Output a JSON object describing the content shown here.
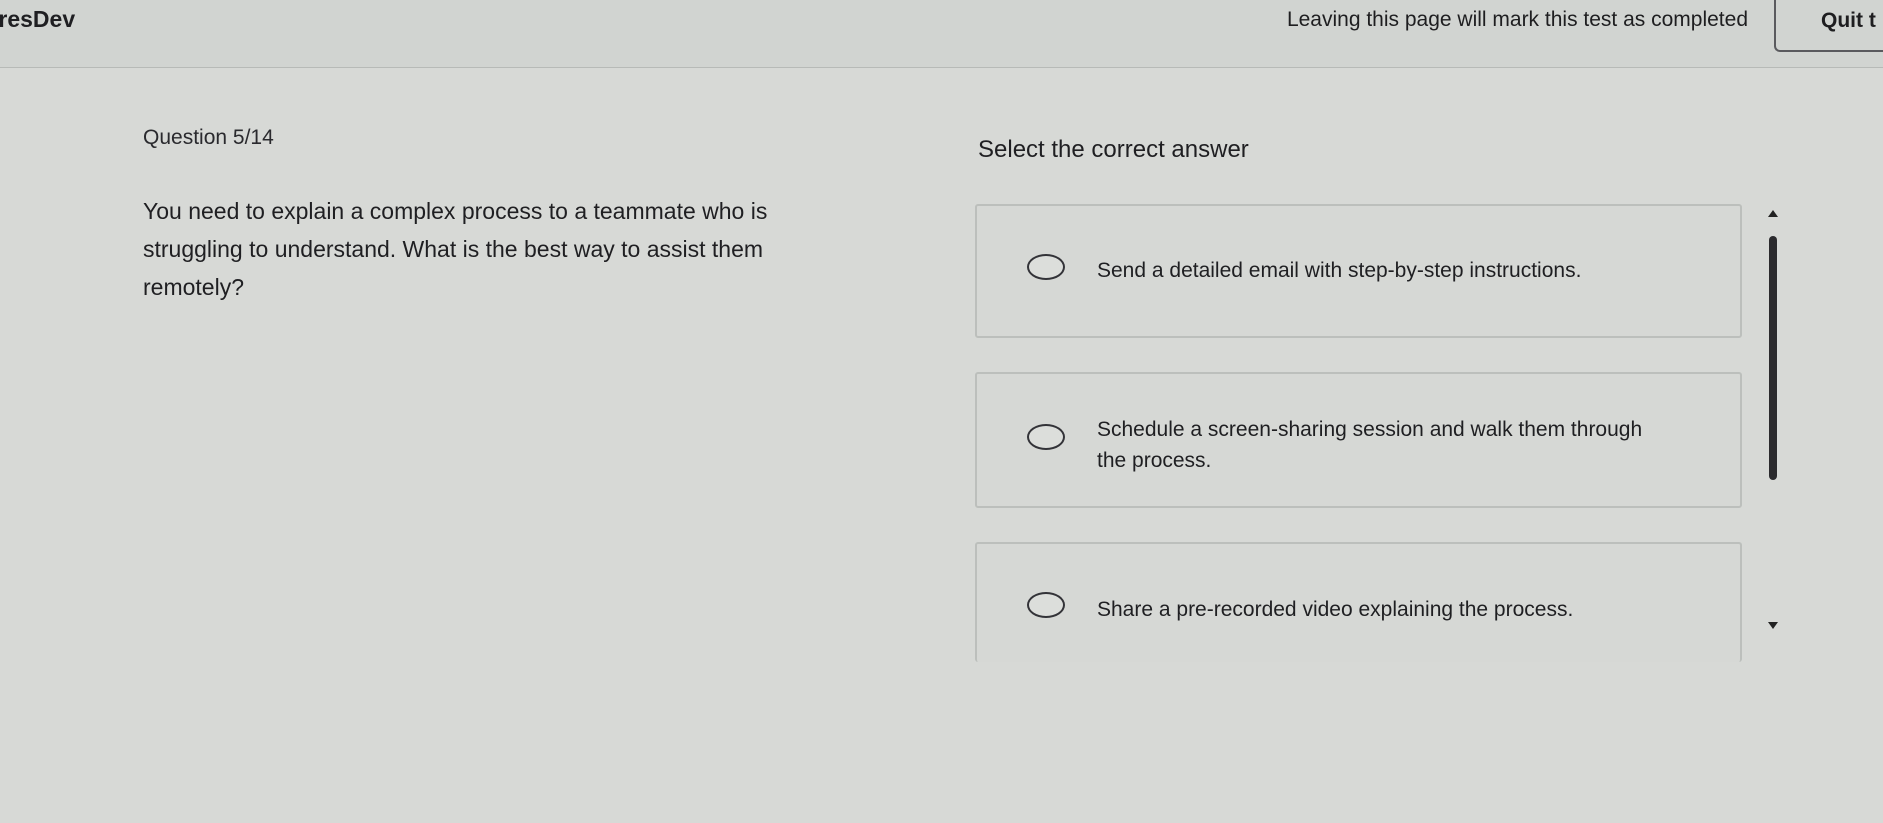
{
  "header": {
    "brand": "iresDev",
    "leave_notice": "Leaving this page will mark this test as completed",
    "quit_label": "Quit t"
  },
  "question": {
    "counter": "Question 5/14",
    "text": "You need to explain a complex process to a teammate who is struggling to understand. What is the best way to assist them remotely?"
  },
  "answers": {
    "instruction": "Select the correct answer",
    "options": [
      {
        "label": "Send a detailed email with step-by-step instructions."
      },
      {
        "label": "Schedule a screen-sharing session and walk them through the process."
      },
      {
        "label": "Share a pre-recorded video explaining the process."
      }
    ]
  }
}
